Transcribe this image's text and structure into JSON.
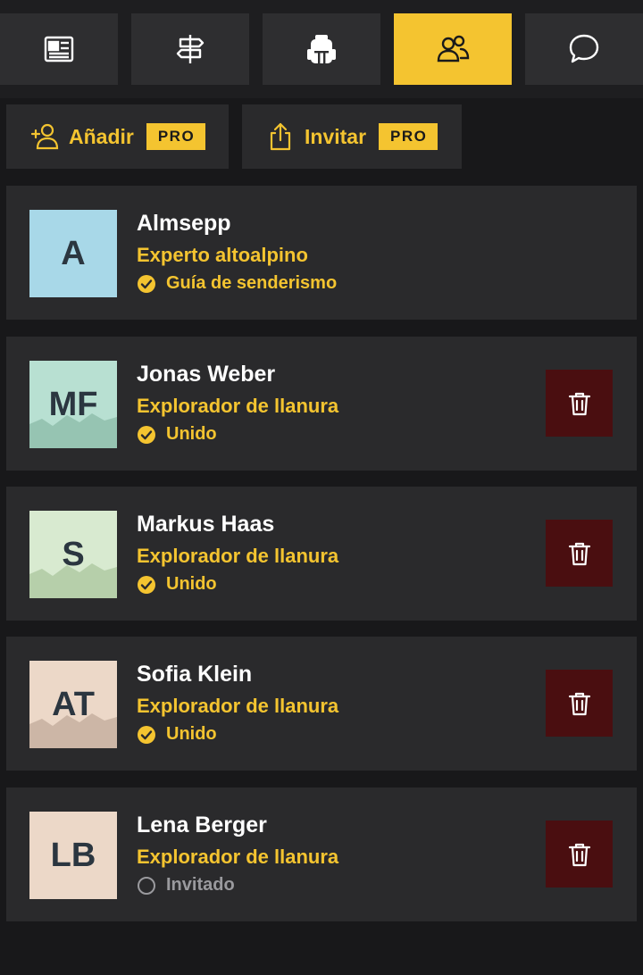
{
  "tabs": [
    {
      "icon": "newspaper-icon",
      "active": false
    },
    {
      "icon": "signpost-icon",
      "active": false
    },
    {
      "icon": "backpack-icon",
      "active": false
    },
    {
      "icon": "users-icon",
      "active": true
    },
    {
      "icon": "chat-icon",
      "active": false
    }
  ],
  "actions": {
    "add_label": "Añadir",
    "add_badge": "PRO",
    "invite_label": "Invitar",
    "invite_badge": "PRO"
  },
  "members": [
    {
      "initials": "A",
      "name": "Almsepp",
      "role": "Experto altoalpino",
      "status": "Guía de senderismo",
      "status_type": "confirmed",
      "deletable": false,
      "avatar_color": "#a8d8e8",
      "avatar_mountain": false
    },
    {
      "initials": "MF",
      "name": "Jonas Weber",
      "role": "Explorador de llanura",
      "status": "Unido",
      "status_type": "confirmed",
      "deletable": true,
      "avatar_color": "#b8e0d2",
      "avatar_mountain": true,
      "mountain_color": "#96c4b2"
    },
    {
      "initials": "S",
      "name": "Markus Haas",
      "role": "Explorador de llanura",
      "status": "Unido",
      "status_type": "confirmed",
      "deletable": true,
      "avatar_color": "#d8ead0",
      "avatar_mountain": true,
      "mountain_color": "#b6cfaa"
    },
    {
      "initials": "AT",
      "name": "Sofia Klein",
      "role": "Explorador de llanura",
      "status": "Unido",
      "status_type": "confirmed",
      "deletable": true,
      "avatar_color": "#ecd8c8",
      "avatar_mountain": true,
      "mountain_color": "#ccb6a6"
    },
    {
      "initials": "LB",
      "name": "Lena Berger",
      "role": "Explorador de llanura",
      "status": "Invitado",
      "status_type": "pending",
      "deletable": true,
      "avatar_color": "#ecd8c8",
      "avatar_mountain": false
    }
  ],
  "colors": {
    "accent": "#f4c430",
    "card": "#2a2a2c",
    "delete_bg": "#4a0e10",
    "pending": "#9a9a9e"
  }
}
